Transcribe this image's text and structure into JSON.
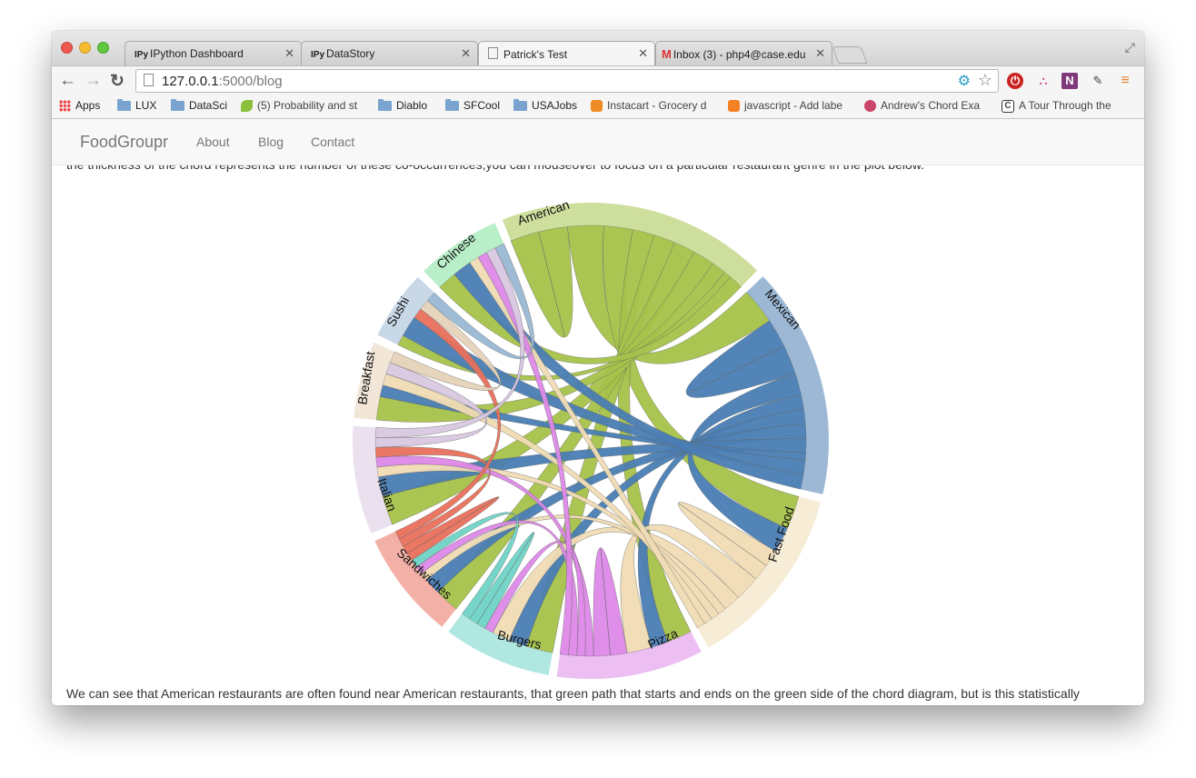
{
  "tabs": [
    {
      "icon": "IPy",
      "label": "IPython Dashboard"
    },
    {
      "icon": "IPy",
      "label": "DataStory"
    },
    {
      "icon": "",
      "label": "Patrick's Test"
    },
    {
      "icon": "M",
      "label": "Inbox (3) - php4@case.edu"
    }
  ],
  "toolbar": {
    "url_host": "127.0.0.1",
    "url_rest": ":5000/blog"
  },
  "bookmarks": [
    {
      "label": "Apps",
      "icon": "apps-icon"
    },
    {
      "label": "LUX",
      "icon": "folder-icon"
    },
    {
      "label": "DataSci",
      "icon": "folder-icon"
    },
    {
      "label": "(5) Probability and st",
      "icon": "leaf-icon"
    },
    {
      "label": "Diablo",
      "icon": "folder-icon"
    },
    {
      "label": "SFCool",
      "icon": "folder-icon"
    },
    {
      "label": "USAJobs",
      "icon": "folder-icon"
    },
    {
      "label": "Instacart - Grocery d",
      "icon": "carrot-icon"
    },
    {
      "label": "javascript - Add labe",
      "icon": "stack-icon"
    },
    {
      "label": "Andrew's Chord Exa",
      "icon": "globe-icon"
    },
    {
      "label": "A Tour Through the",
      "icon": "c-icon"
    }
  ],
  "site": {
    "brand": "FoodGroupr",
    "nav": [
      "About",
      "Blog",
      "Contact"
    ]
  },
  "text": {
    "top": "the thickness of the chord represents the number of these co-occurrences,you can mouseover to focus on a particular restaurant genre in the plot below.",
    "bottom": "We can see that American restaurants are often found near American restaurants, that green path that starts and ends on the green side of the chord diagram, but is this statistically"
  },
  "colors": {
    "American": "#a6c24a",
    "Mexican": "#4a7db3",
    "Fast Food": "#f0dcb4",
    "Pizza": "#dd88e8",
    "Burgers": "#6fd3c6",
    "Sandwiches": "#e8705c",
    "Italian": "#d8c7e0",
    "Breakfast": "#e6d2b8",
    "Sushi": "#9ab8d4",
    "Chinese": "#7de09a"
  },
  "chart_data": {
    "type": "chord",
    "groups": [
      {
        "name": "American",
        "share": 0.175
      },
      {
        "name": "Mexican",
        "share": 0.15
      },
      {
        "name": "Fast Food",
        "share": 0.12
      },
      {
        "name": "Pizza",
        "share": 0.095
      },
      {
        "name": "Burgers",
        "share": 0.07
      },
      {
        "name": "Sandwiches",
        "share": 0.07
      },
      {
        "name": "Italian",
        "share": 0.07
      },
      {
        "name": "Breakfast",
        "share": 0.05
      },
      {
        "name": "Sushi",
        "share": 0.045
      },
      {
        "name": "Chinese",
        "share": 0.055
      }
    ],
    "chords": [
      [
        "American",
        "American",
        4
      ],
      [
        "American",
        "Mexican",
        5
      ],
      [
        "American",
        "Fast Food",
        4
      ],
      [
        "American",
        "Pizza",
        3
      ],
      [
        "American",
        "Burgers",
        3
      ],
      [
        "American",
        "Sandwiches",
        3
      ],
      [
        "American",
        "Italian",
        3
      ],
      [
        "American",
        "Breakfast",
        2
      ],
      [
        "American",
        "Sushi",
        1
      ],
      [
        "American",
        "Chinese",
        2
      ],
      [
        "Mexican",
        "Mexican",
        4
      ],
      [
        "Mexican",
        "Fast Food",
        3
      ],
      [
        "Mexican",
        "Pizza",
        2
      ],
      [
        "Mexican",
        "Burgers",
        2
      ],
      [
        "Mexican",
        "Sandwiches",
        2
      ],
      [
        "Mexican",
        "Italian",
        2
      ],
      [
        "Mexican",
        "Breakfast",
        1
      ],
      [
        "Mexican",
        "Sushi",
        2
      ],
      [
        "Mexican",
        "Chinese",
        2
      ],
      [
        "Fast Food",
        "Fast Food",
        2
      ],
      [
        "Fast Food",
        "Pizza",
        3
      ],
      [
        "Fast Food",
        "Burgers",
        2
      ],
      [
        "Fast Food",
        "Sandwiches",
        1
      ],
      [
        "Fast Food",
        "Italian",
        1
      ],
      [
        "Fast Food",
        "Breakfast",
        1
      ],
      [
        "Fast Food",
        "Chinese",
        1
      ],
      [
        "Pizza",
        "Pizza",
        2
      ],
      [
        "Pizza",
        "Italian",
        1
      ],
      [
        "Pizza",
        "Burgers",
        1
      ],
      [
        "Pizza",
        "Sandwiches",
        1
      ],
      [
        "Pizza",
        "Chinese",
        1
      ],
      [
        "Burgers",
        "Burgers",
        1
      ],
      [
        "Burgers",
        "Sandwiches",
        1
      ],
      [
        "Sandwiches",
        "Sandwiches",
        1
      ],
      [
        "Sandwiches",
        "Italian",
        1
      ],
      [
        "Sandwiches",
        "Sushi",
        1
      ],
      [
        "Italian",
        "Breakfast",
        1
      ],
      [
        "Italian",
        "Chinese",
        1
      ],
      [
        "Breakfast",
        "Sushi",
        1
      ],
      [
        "Sushi",
        "Chinese",
        1
      ]
    ]
  }
}
